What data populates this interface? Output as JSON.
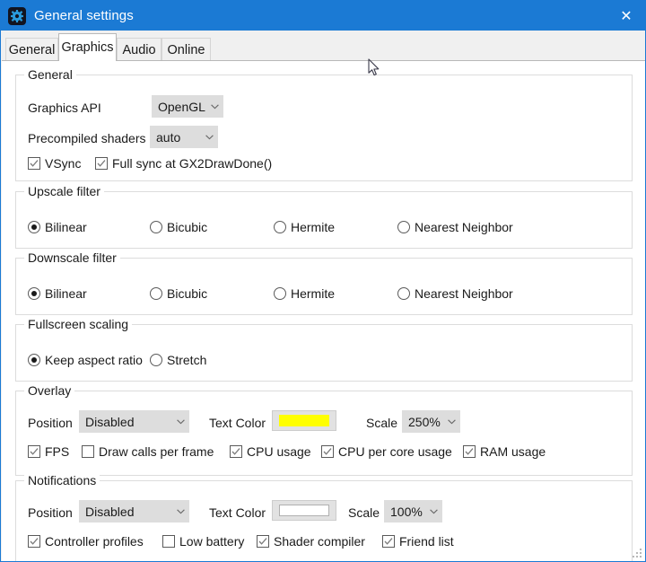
{
  "window": {
    "title": "General settings",
    "icon": "gear-icon",
    "close_label": "✕",
    "accent_color": "#1b7ad4"
  },
  "tabs": [
    {
      "label": "General",
      "selected": false
    },
    {
      "label": "Graphics",
      "selected": true
    },
    {
      "label": "Audio",
      "selected": false
    },
    {
      "label": "Online",
      "selected": false
    }
  ],
  "groups": {
    "general": {
      "legend": "General",
      "graphics_api_label": "Graphics API",
      "graphics_api_value": "OpenGL",
      "precompiled_label": "Precompiled shaders",
      "precompiled_value": "auto",
      "vsync": {
        "label": "VSync",
        "checked": true
      },
      "full_sync": {
        "label": "Full sync at GX2DrawDone()",
        "checked": true
      }
    },
    "upscale": {
      "legend": "Upscale filter",
      "options": [
        {
          "label": "Bilinear",
          "selected": true
        },
        {
          "label": "Bicubic",
          "selected": false
        },
        {
          "label": "Hermite",
          "selected": false
        },
        {
          "label": "Nearest Neighbor",
          "selected": false
        }
      ]
    },
    "downscale": {
      "legend": "Downscale filter",
      "options": [
        {
          "label": "Bilinear",
          "selected": true
        },
        {
          "label": "Bicubic",
          "selected": false
        },
        {
          "label": "Hermite",
          "selected": false
        },
        {
          "label": "Nearest Neighbor",
          "selected": false
        }
      ]
    },
    "fullscreen": {
      "legend": "Fullscreen scaling",
      "options": [
        {
          "label": "Keep aspect ratio",
          "selected": true
        },
        {
          "label": "Stretch",
          "selected": false
        }
      ]
    },
    "overlay": {
      "legend": "Overlay",
      "position_label": "Position",
      "position_value": "Disabled",
      "text_color_label": "Text Color",
      "text_color_value": "#ffff00",
      "scale_label": "Scale",
      "scale_value": "250%",
      "checkboxes": [
        {
          "label": "FPS",
          "checked": true
        },
        {
          "label": "Draw calls per frame",
          "checked": false
        },
        {
          "label": "CPU usage",
          "checked": true
        },
        {
          "label": "CPU per core usage",
          "checked": true
        },
        {
          "label": "RAM usage",
          "checked": true
        }
      ]
    },
    "notifications": {
      "legend": "Notifications",
      "position_label": "Position",
      "position_value": "Disabled",
      "text_color_label": "Text Color",
      "text_color_value": "#ffffff",
      "scale_label": "Scale",
      "scale_value": "100%",
      "checkboxes": [
        {
          "label": "Controller profiles",
          "checked": true
        },
        {
          "label": "Low battery",
          "checked": false
        },
        {
          "label": "Shader compiler",
          "checked": true
        },
        {
          "label": "Friend list",
          "checked": true
        }
      ]
    }
  }
}
